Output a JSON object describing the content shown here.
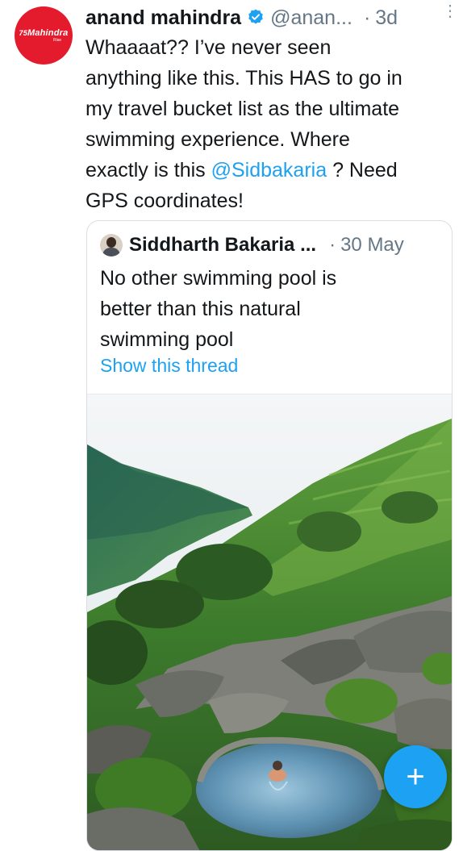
{
  "tweet": {
    "avatar_brand": "Mahindra",
    "avatar_sub": "Rise",
    "author_name": "anand mahindra",
    "handle": "@anan...",
    "dot": "·",
    "time": "3d",
    "more_icon": "⋮",
    "text_lines": [
      "Whaaaat?? I’ve never seen",
      "anything like this. This HAS to go in",
      "my travel bucket list as the ultimate",
      "swimming experience. Where"
    ],
    "text_line5_pre": "exactly is this ",
    "mention": "@Sidbakaria",
    "text_line5_post": " ? Need",
    "text_line6": "GPS coordinates!"
  },
  "quote": {
    "author_name": "Siddharth Bakaria ...",
    "dot": "·",
    "time": "30 May",
    "text_lines": [
      "No other swimming pool is",
      "better than this natural",
      "swimming pool"
    ],
    "link": "Show this thread"
  },
  "fab": {
    "label": "+",
    "color": "#1da1f2"
  },
  "colors": {
    "accent": "#1da1f2",
    "avatar_red": "#e31b2d"
  }
}
